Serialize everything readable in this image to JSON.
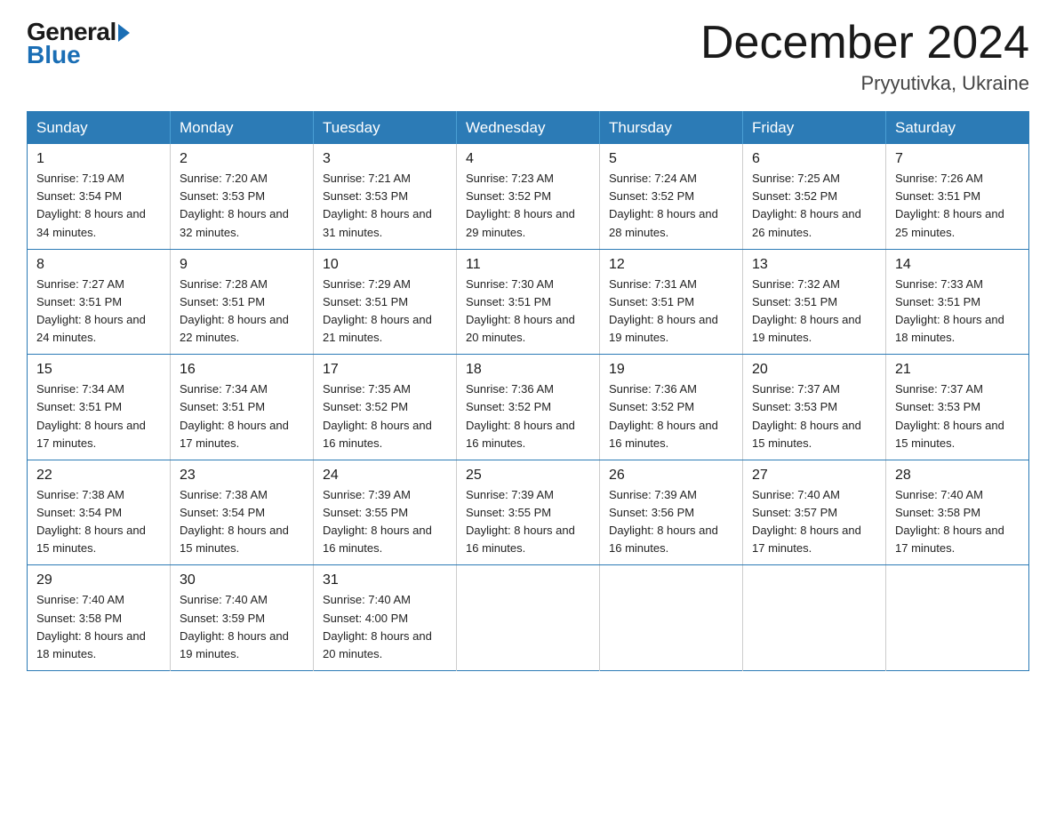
{
  "header": {
    "logo_general": "General",
    "logo_blue": "Blue",
    "month_title": "December 2024",
    "location": "Pryyutivka, Ukraine"
  },
  "weekdays": [
    "Sunday",
    "Monday",
    "Tuesday",
    "Wednesday",
    "Thursday",
    "Friday",
    "Saturday"
  ],
  "weeks": [
    [
      {
        "day": "1",
        "sunrise": "7:19 AM",
        "sunset": "3:54 PM",
        "daylight": "8 hours and 34 minutes."
      },
      {
        "day": "2",
        "sunrise": "7:20 AM",
        "sunset": "3:53 PM",
        "daylight": "8 hours and 32 minutes."
      },
      {
        "day": "3",
        "sunrise": "7:21 AM",
        "sunset": "3:53 PM",
        "daylight": "8 hours and 31 minutes."
      },
      {
        "day": "4",
        "sunrise": "7:23 AM",
        "sunset": "3:52 PM",
        "daylight": "8 hours and 29 minutes."
      },
      {
        "day": "5",
        "sunrise": "7:24 AM",
        "sunset": "3:52 PM",
        "daylight": "8 hours and 28 minutes."
      },
      {
        "day": "6",
        "sunrise": "7:25 AM",
        "sunset": "3:52 PM",
        "daylight": "8 hours and 26 minutes."
      },
      {
        "day": "7",
        "sunrise": "7:26 AM",
        "sunset": "3:51 PM",
        "daylight": "8 hours and 25 minutes."
      }
    ],
    [
      {
        "day": "8",
        "sunrise": "7:27 AM",
        "sunset": "3:51 PM",
        "daylight": "8 hours and 24 minutes."
      },
      {
        "day": "9",
        "sunrise": "7:28 AM",
        "sunset": "3:51 PM",
        "daylight": "8 hours and 22 minutes."
      },
      {
        "day": "10",
        "sunrise": "7:29 AM",
        "sunset": "3:51 PM",
        "daylight": "8 hours and 21 minutes."
      },
      {
        "day": "11",
        "sunrise": "7:30 AM",
        "sunset": "3:51 PM",
        "daylight": "8 hours and 20 minutes."
      },
      {
        "day": "12",
        "sunrise": "7:31 AM",
        "sunset": "3:51 PM",
        "daylight": "8 hours and 19 minutes."
      },
      {
        "day": "13",
        "sunrise": "7:32 AM",
        "sunset": "3:51 PM",
        "daylight": "8 hours and 19 minutes."
      },
      {
        "day": "14",
        "sunrise": "7:33 AM",
        "sunset": "3:51 PM",
        "daylight": "8 hours and 18 minutes."
      }
    ],
    [
      {
        "day": "15",
        "sunrise": "7:34 AM",
        "sunset": "3:51 PM",
        "daylight": "8 hours and 17 minutes."
      },
      {
        "day": "16",
        "sunrise": "7:34 AM",
        "sunset": "3:51 PM",
        "daylight": "8 hours and 17 minutes."
      },
      {
        "day": "17",
        "sunrise": "7:35 AM",
        "sunset": "3:52 PM",
        "daylight": "8 hours and 16 minutes."
      },
      {
        "day": "18",
        "sunrise": "7:36 AM",
        "sunset": "3:52 PM",
        "daylight": "8 hours and 16 minutes."
      },
      {
        "day": "19",
        "sunrise": "7:36 AM",
        "sunset": "3:52 PM",
        "daylight": "8 hours and 16 minutes."
      },
      {
        "day": "20",
        "sunrise": "7:37 AM",
        "sunset": "3:53 PM",
        "daylight": "8 hours and 15 minutes."
      },
      {
        "day": "21",
        "sunrise": "7:37 AM",
        "sunset": "3:53 PM",
        "daylight": "8 hours and 15 minutes."
      }
    ],
    [
      {
        "day": "22",
        "sunrise": "7:38 AM",
        "sunset": "3:54 PM",
        "daylight": "8 hours and 15 minutes."
      },
      {
        "day": "23",
        "sunrise": "7:38 AM",
        "sunset": "3:54 PM",
        "daylight": "8 hours and 15 minutes."
      },
      {
        "day": "24",
        "sunrise": "7:39 AM",
        "sunset": "3:55 PM",
        "daylight": "8 hours and 16 minutes."
      },
      {
        "day": "25",
        "sunrise": "7:39 AM",
        "sunset": "3:55 PM",
        "daylight": "8 hours and 16 minutes."
      },
      {
        "day": "26",
        "sunrise": "7:39 AM",
        "sunset": "3:56 PM",
        "daylight": "8 hours and 16 minutes."
      },
      {
        "day": "27",
        "sunrise": "7:40 AM",
        "sunset": "3:57 PM",
        "daylight": "8 hours and 17 minutes."
      },
      {
        "day": "28",
        "sunrise": "7:40 AM",
        "sunset": "3:58 PM",
        "daylight": "8 hours and 17 minutes."
      }
    ],
    [
      {
        "day": "29",
        "sunrise": "7:40 AM",
        "sunset": "3:58 PM",
        "daylight": "8 hours and 18 minutes."
      },
      {
        "day": "30",
        "sunrise": "7:40 AM",
        "sunset": "3:59 PM",
        "daylight": "8 hours and 19 minutes."
      },
      {
        "day": "31",
        "sunrise": "7:40 AM",
        "sunset": "4:00 PM",
        "daylight": "8 hours and 20 minutes."
      },
      null,
      null,
      null,
      null
    ]
  ]
}
